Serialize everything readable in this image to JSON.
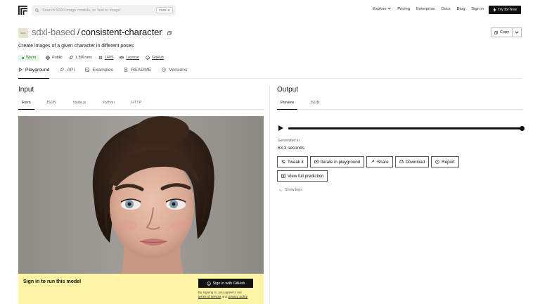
{
  "nav": {
    "search_placeholder": "Search 5000 image models, or 'text to image'",
    "search_shortcut": "CMD+K",
    "links": [
      "Explore",
      "Pricing",
      "Enterprise",
      "Docs",
      "Blog",
      "Sign in"
    ],
    "cta": "Try for free"
  },
  "model": {
    "owner": "sdxl-based",
    "separator": "/",
    "name": "consistent-character",
    "icon_text": "SDXL",
    "copy_label": "Copy",
    "description": "Create images of a given character in different poses",
    "status": "Warm",
    "visibility": "Public",
    "runs": "1.3M runs",
    "hardware": "L40S",
    "license": "License",
    "github": "GitHub"
  },
  "tabs": [
    "Playground",
    "API",
    "Examples",
    "README",
    "Versions"
  ],
  "input": {
    "title": "Input",
    "subtabs": [
      "Form",
      "JSON",
      "Node.js",
      "Python",
      "HTTP"
    ],
    "signin_prompt": "Sign in to run this model",
    "github_button": "Sign in with GitHub",
    "agree_prefix": "By signing in, you agree to our",
    "terms": "terms of service",
    "and": "and",
    "privacy": "privacy policy"
  },
  "output": {
    "title": "Output",
    "subtabs": [
      "Preview",
      "JSON"
    ],
    "generated_label": "Generated in",
    "generated_time": "63.2 seconds",
    "buttons": [
      "Tweak it",
      "Iterate in playground",
      "Share",
      "Download",
      "Report"
    ],
    "full_prediction": "View full prediction",
    "show_logs": "Show logs",
    "playback_progress": 1.0
  },
  "colors": {
    "accent": "#111111",
    "warm_bg": "#e6f4e6",
    "warm_text": "#2f7d32",
    "signin_bg": "#fdf5a6"
  }
}
